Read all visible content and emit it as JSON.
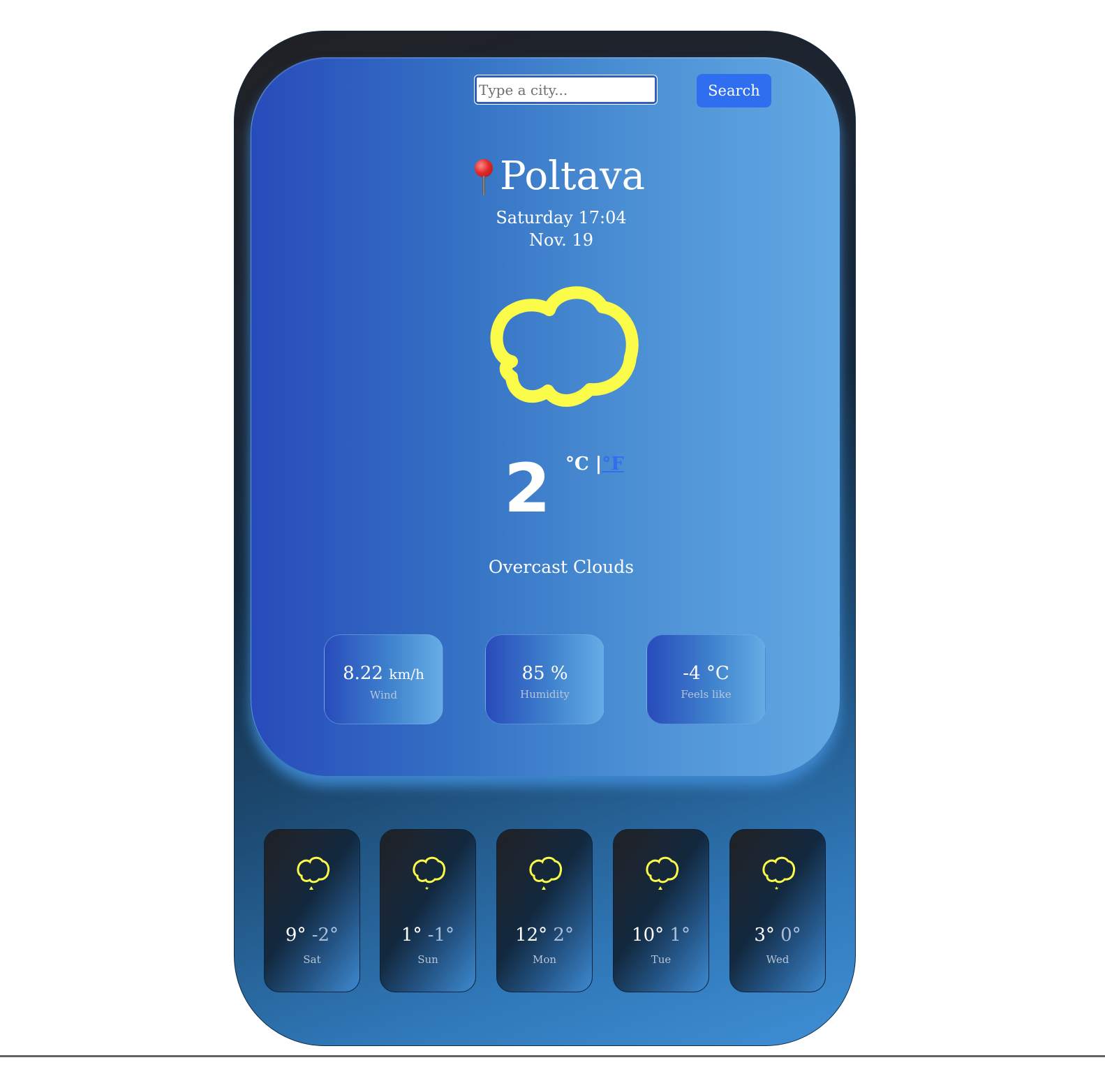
{
  "search": {
    "placeholder": "Type a city...",
    "value": "",
    "button_label": "Search"
  },
  "location": {
    "icon": "round-pushpin-icon",
    "city": "Poltava"
  },
  "datetime": {
    "day_time": "Saturday 17:04",
    "date": "Nov. 19"
  },
  "current": {
    "icon": "cloud-icon",
    "temperature": "2",
    "unit_celsius": "°C",
    "unit_separator": "|",
    "unit_fahrenheit": "°F",
    "description": "Overcast Clouds"
  },
  "stats": [
    {
      "value": "8.22",
      "unit": "km/h",
      "label": "Wind"
    },
    {
      "value": "85",
      "unit": "%",
      "label": "Humidity"
    },
    {
      "value": "-4",
      "unit": "°C",
      "label": "Feels like"
    }
  ],
  "forecast": [
    {
      "day": "Sat",
      "high": "9°",
      "low": "-2°",
      "icon": "cloud-rain-icon"
    },
    {
      "day": "Sun",
      "high": "1°",
      "low": "-1°",
      "icon": "cloud-snow-icon"
    },
    {
      "day": "Mon",
      "high": "12°",
      "low": "2°",
      "icon": "cloud-rain-icon"
    },
    {
      "day": "Tue",
      "high": "10°",
      "low": "1°",
      "icon": "cloud-rain-icon"
    },
    {
      "day": "Wed",
      "high": "3°",
      "low": "0°",
      "icon": "cloud-snow-icon"
    }
  ],
  "colors": {
    "accent": "#2f6fef",
    "icon_yellow": "#fbfb4a",
    "panel_start": "#284bbb",
    "panel_end": "#63a9e3"
  }
}
